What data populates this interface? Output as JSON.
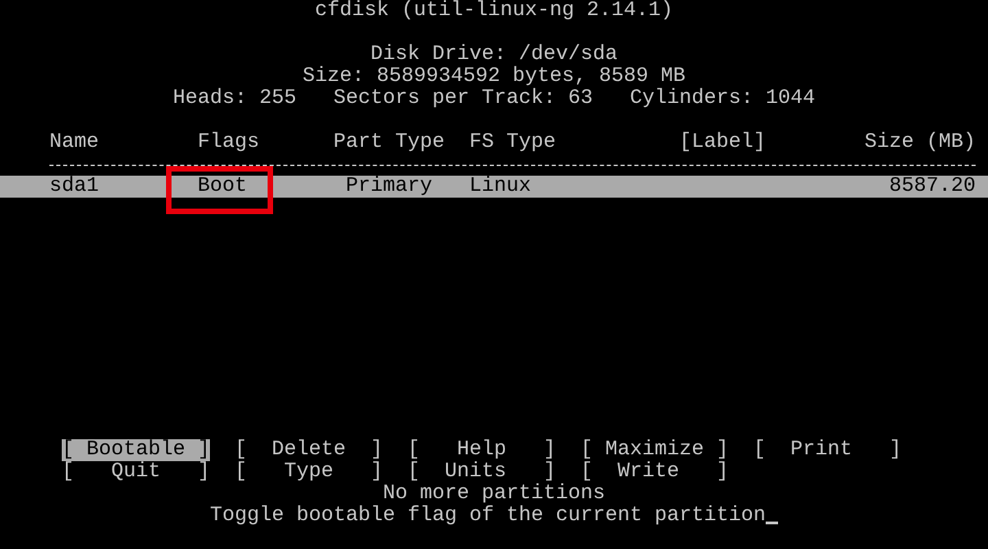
{
  "title": "cfdisk (util-linux-ng 2.14.1)",
  "disk_info": [
    "Disk Drive: /dev/sda",
    "Size: 8589934592 bytes, 8589 MB",
    "Heads: 255   Sectors per Track: 63   Cylinders: 1044"
  ],
  "table": {
    "columns": [
      "Name",
      "Flags",
      "Part Type",
      "FS Type",
      "[Label]",
      "Size (MB)"
    ],
    "rows": [
      {
        "cells": [
          "sda1",
          "Boot",
          "Primary",
          "Linux",
          "",
          "8587.20"
        ],
        "selected": true,
        "flags_boxed": true
      }
    ]
  },
  "menu": [
    {
      "label": "[ Bootable ]",
      "selected": true
    },
    {
      "label": "[  Delete  ]",
      "selected": false
    },
    {
      "label": "[   Help   ]",
      "selected": false
    },
    {
      "label": "[ Maximize ]",
      "selected": false
    },
    {
      "label": "[  Print   ]",
      "selected": false
    },
    {
      "label": "[   Quit   ]",
      "selected": false
    },
    {
      "label": "[   Type   ]",
      "selected": false
    },
    {
      "label": "[  Units   ]",
      "selected": false
    },
    {
      "label": "[  Write   ]",
      "selected": false
    }
  ],
  "status_message": "No more partitions",
  "help_text": "Toggle bootable flag of the current partition",
  "cursor_visible": true
}
